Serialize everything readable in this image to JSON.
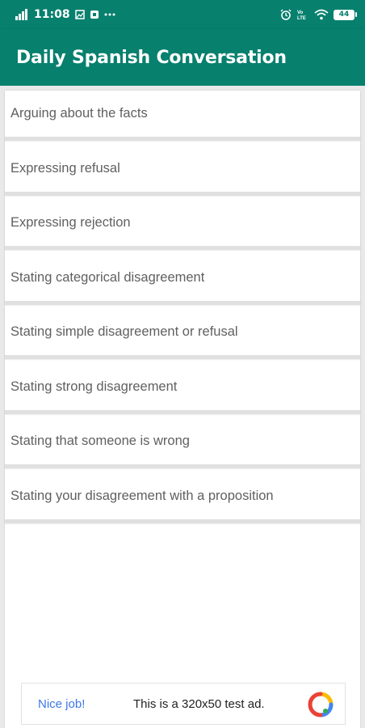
{
  "status_bar": {
    "time": "11:08",
    "battery": "44",
    "icons": [
      "signal-icon",
      "image-notification-icon",
      "app-notification-icon",
      "more-icon",
      "alarm-icon",
      "volte-icon",
      "wifi-icon",
      "battery-icon"
    ],
    "volte_label": "Vo LTE"
  },
  "app_bar": {
    "title": "Daily Spanish Conversation",
    "color": "#07806e"
  },
  "topics": [
    {
      "label": "Arguing about the facts"
    },
    {
      "label": "Expressing refusal"
    },
    {
      "label": "Expressing rejection"
    },
    {
      "label": "Stating categorical disagreement"
    },
    {
      "label": "Stating simple disagreement or refusal"
    },
    {
      "label": "Stating strong disagreement"
    },
    {
      "label": "Stating that someone is wrong"
    },
    {
      "label": "Stating your disagreement with a proposition"
    }
  ],
  "ad": {
    "nice": "Nice job!",
    "text": "This is a 320x50 test ad.",
    "nice_color": "#3c78e6"
  }
}
